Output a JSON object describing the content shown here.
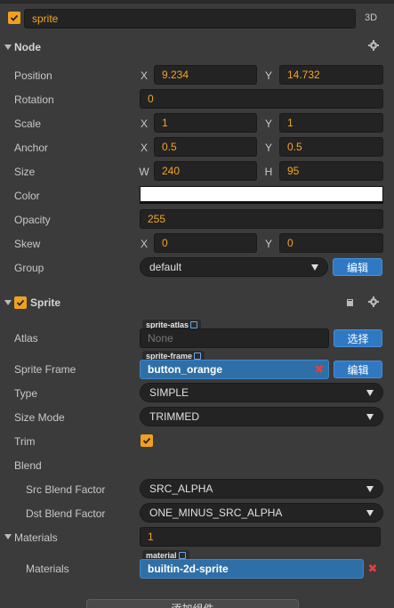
{
  "node_header": {
    "name": "sprite",
    "mode_label": "3D"
  },
  "node_section": {
    "title": "Node",
    "position": {
      "label": "Position",
      "x_axis": "X",
      "x": "9.234",
      "y_axis": "Y",
      "y": "14.732"
    },
    "rotation": {
      "label": "Rotation",
      "value": "0"
    },
    "scale": {
      "label": "Scale",
      "x_axis": "X",
      "x": "1",
      "y_axis": "Y",
      "y": "1"
    },
    "anchor": {
      "label": "Anchor",
      "x_axis": "X",
      "x": "0.5",
      "y_axis": "Y",
      "y": "0.5"
    },
    "size": {
      "label": "Size",
      "w_axis": "W",
      "w": "240",
      "h_axis": "H",
      "h": "95"
    },
    "color": {
      "label": "Color",
      "value": "#ffffff"
    },
    "opacity": {
      "label": "Opacity",
      "value": "255"
    },
    "skew": {
      "label": "Skew",
      "x_axis": "X",
      "x": "0",
      "y_axis": "Y",
      "y": "0"
    },
    "group": {
      "label": "Group",
      "value": "default",
      "edit_label": "编辑"
    }
  },
  "sprite_section": {
    "title": "Sprite",
    "atlas": {
      "label": "Atlas",
      "tag": "sprite-atlas",
      "value": "None",
      "select_label": "选择"
    },
    "sprite_frame": {
      "label": "Sprite Frame",
      "tag": "sprite-frame",
      "value": "button_orange",
      "edit_label": "编辑"
    },
    "type": {
      "label": "Type",
      "value": "SIMPLE"
    },
    "size_mode": {
      "label": "Size Mode",
      "value": "TRIMMED"
    },
    "trim": {
      "label": "Trim",
      "checked": true
    },
    "blend": {
      "label": "Blend"
    },
    "src_blend": {
      "label": "Src Blend Factor",
      "value": "SRC_ALPHA"
    },
    "dst_blend": {
      "label": "Dst Blend Factor",
      "value": "ONE_MINUS_SRC_ALPHA"
    },
    "materials_count": {
      "label": "Materials",
      "value": "1"
    },
    "material_item": {
      "label": "Materials",
      "tag": "material",
      "value": "builtin-2d-sprite"
    }
  },
  "footer": {
    "add_component_label": "添加组件"
  },
  "colors": {
    "accent_orange": "#f0a020",
    "select_blue": "#2f6fa8",
    "button_blue": "#2f78c4",
    "panel_bg": "#3b3b3b",
    "field_bg": "#232323"
  },
  "icons": [
    "checkbox-icon",
    "gear-icon",
    "book-icon",
    "collapse-triangle-icon",
    "dropdown-caret-icon",
    "link-icon",
    "clear-x-icon"
  ]
}
